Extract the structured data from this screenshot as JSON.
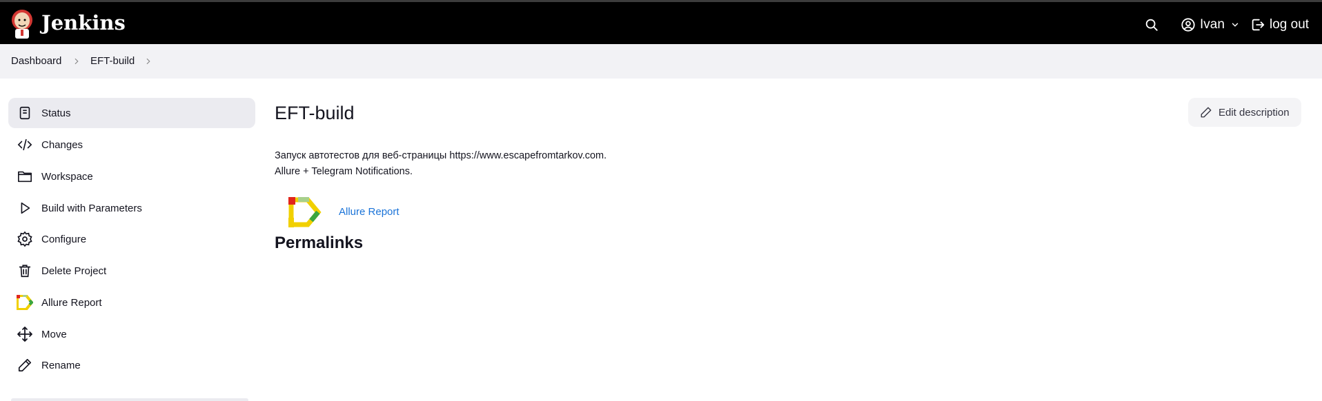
{
  "header": {
    "brand": "Jenkins",
    "user": "Ivan",
    "logout_label": "log out",
    "icons": [
      "jenkins-logo-icon",
      "search-icon",
      "user-icon",
      "chevron-down-icon",
      "logout-icon"
    ]
  },
  "breadcrumb": {
    "items": [
      "Dashboard",
      "EFT-build"
    ]
  },
  "sidebar": {
    "items": [
      {
        "label": "Status",
        "icon": "status-icon",
        "active": true
      },
      {
        "label": "Changes",
        "icon": "code-icon"
      },
      {
        "label": "Workspace",
        "icon": "folder-icon"
      },
      {
        "label": "Build with Parameters",
        "icon": "play-icon"
      },
      {
        "label": "Configure",
        "icon": "gear-icon"
      },
      {
        "label": "Delete Project",
        "icon": "trash-icon"
      },
      {
        "label": "Allure Report",
        "icon": "allure-icon"
      },
      {
        "label": "Move",
        "icon": "move-icon"
      },
      {
        "label": "Rename",
        "icon": "pencil-icon"
      }
    ]
  },
  "main": {
    "title": "EFT-build",
    "edit_description_label": "Edit description",
    "description_lines": [
      "Запуск автотестов для веб-страницы https://www.escapefromtarkov.com.",
      "Allure + Telegram Notifications."
    ],
    "allure_link": "Allure Report",
    "permalinks_heading": "Permalinks"
  },
  "colors": {
    "header_bg": "#000000",
    "breadcrumb_bg": "#f2f2f5",
    "active_item_bg": "#ebebf0",
    "link": "#1a73d8"
  }
}
